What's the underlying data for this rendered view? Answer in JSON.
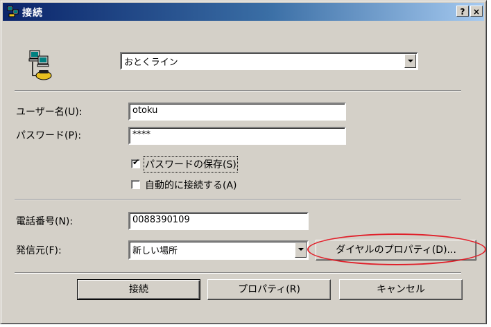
{
  "window": {
    "title": "接続",
    "help_button": "?",
    "close_button": "×"
  },
  "connection": {
    "selected": "おとくライン"
  },
  "fields": {
    "username_label": "ユーザー名(U):",
    "username_value": "otoku",
    "password_label": "パスワード(P):",
    "password_value": "****",
    "save_password_label": "パスワードの保存(S)",
    "save_password_checked": true,
    "auto_connect_label": "自動的に接続する(A)",
    "auto_connect_checked": false,
    "phone_label": "電話番号(N):",
    "phone_value": "0088390109",
    "dial_from_label": "発信元(F):",
    "dial_from_value": "新しい場所",
    "dialing_properties_button": "ダイヤルのプロパティ(D)..."
  },
  "buttons": {
    "connect": "接続",
    "properties": "プロパティ(R)",
    "cancel": "キャンセル"
  },
  "colors": {
    "title_gradient_start": "#0a246a",
    "title_gradient_end": "#a6caf0",
    "dialog_face": "#d4d0c8",
    "highlight_ring": "#e0202a"
  },
  "icons": {
    "title": "network-computers-icon",
    "connection": "dialup-connection-icon"
  }
}
